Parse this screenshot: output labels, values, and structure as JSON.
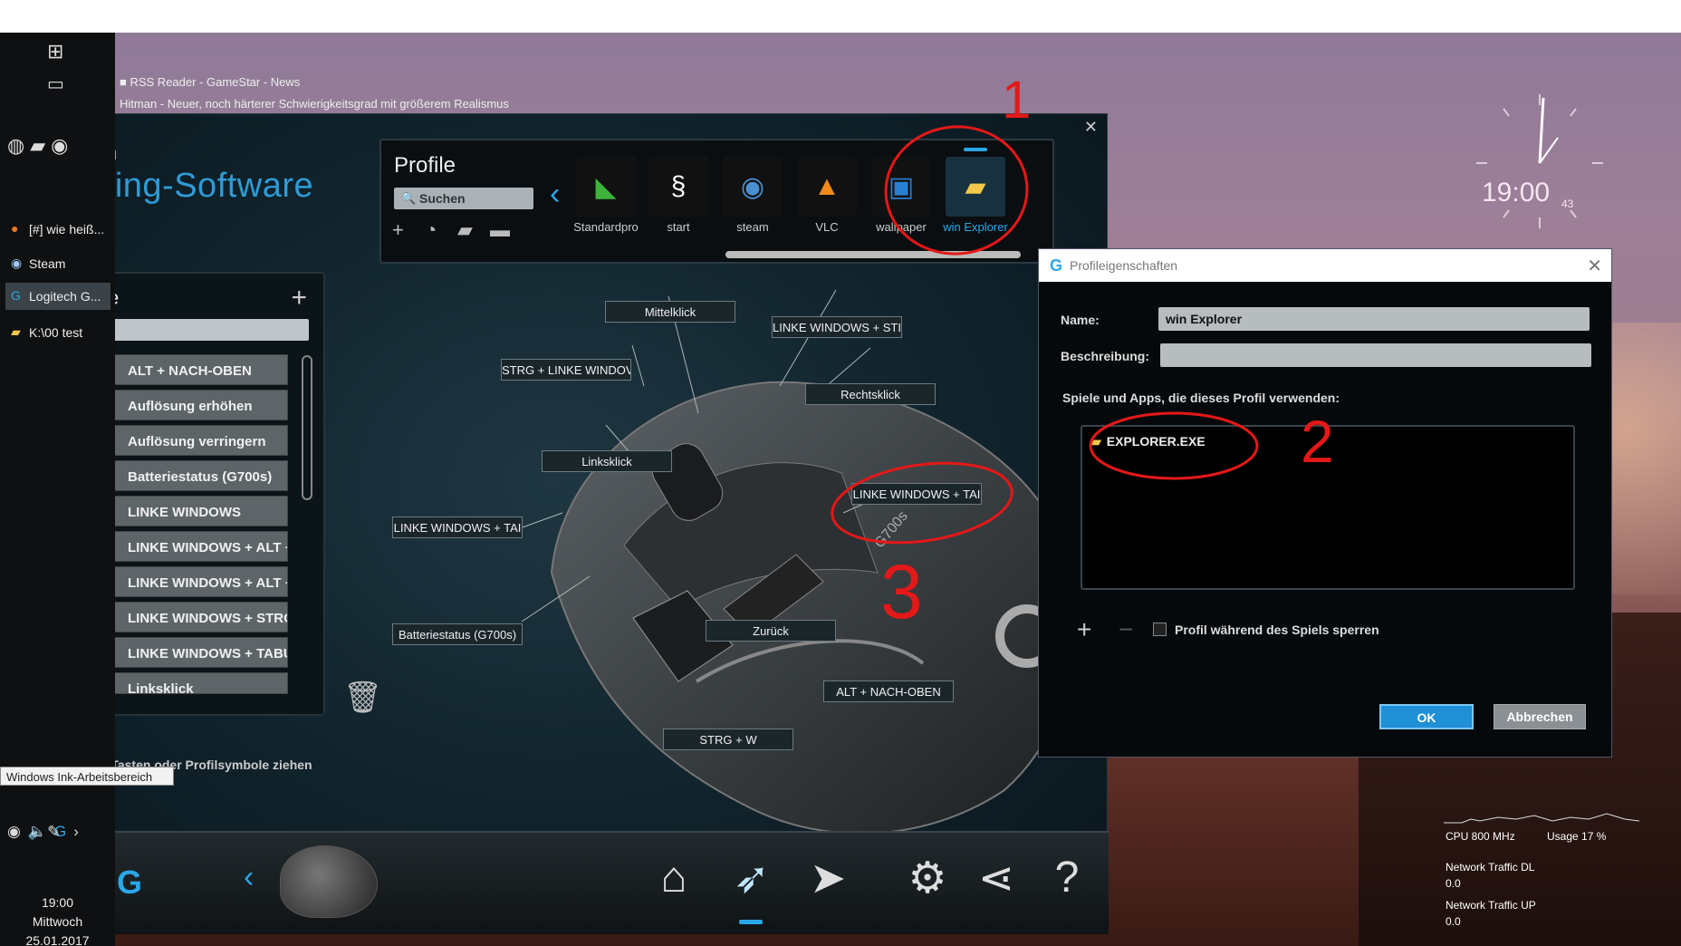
{
  "taskbar": {
    "items": [
      {
        "label": "[#] wie heiß...",
        "icon": "firefox-icon"
      },
      {
        "label": "Steam",
        "icon": "steam-icon"
      },
      {
        "label": "Logitech G...",
        "icon": "logitech-icon"
      },
      {
        "label": "K:\\00 test",
        "icon": "folder-icon"
      }
    ],
    "tooltip": "Windows Ink-Arbeitsbereich",
    "clock": {
      "time": "19:00",
      "day": "Mittwoch",
      "date": "25.01.2017"
    }
  },
  "desktop": {
    "rss_line1": "RSS Reader - GameStar - News",
    "rss_line2": "Hitman - Neuer, noch härterer Schwierigkeitsgrad mit größerem Realismus",
    "clock_time": "19:00",
    "clock_seconds": "43",
    "cpu": "CPU 800 MHz",
    "usage": "Usage 17 %",
    "net_dl": "Network Traffic DL",
    "net_dl_val": "0.0",
    "net_up": "Network Traffic UP",
    "net_up_val": "0.0"
  },
  "gaming_software": {
    "title_partial": "ch",
    "title": "Gaming-Software",
    "profile": {
      "title": "Profile",
      "search_placeholder": "Suchen",
      "items": [
        {
          "label": "Standardpro",
          "icon": "standard-profile-icon",
          "color": "#111"
        },
        {
          "label": "start",
          "icon": "script-icon",
          "color": "#111"
        },
        {
          "label": "steam",
          "icon": "steam-icon",
          "color": "#111"
        },
        {
          "label": "VLC",
          "icon": "vlc-icon",
          "color": "#111"
        },
        {
          "label": "wallpaper",
          "icon": "wallpaper-icon",
          "color": "#111"
        },
        {
          "label": "win Explorer",
          "icon": "folder-icon",
          "color": "#2aa7e8"
        }
      ]
    },
    "commands": {
      "header_partial": "e",
      "search_partial": "n",
      "items": [
        "ALT + NACH-OBEN",
        "Auflösung erhöhen",
        "Auflösung verringern",
        "Batteriestatus (G700s)",
        "LINKE WINDOWS",
        "LINKE WINDOWS + ALT + NACH",
        "LINKE WINDOWS + ALT + NACH",
        "LINKE WINDOWS + STRG + NAC",
        "LINKE WINDOWS + TABULATOI",
        "Linksklick"
      ]
    },
    "hint": "Befehle auf Tasten oder Profilsymbole ziehen",
    "mouse_labels": {
      "middle": "Mittelklick",
      "ctrl_win_top": "LINKE WINDOWS + STI",
      "ctrl_win": "STRG + LINKE WINDOV",
      "right": "Rechtsklick",
      "left": "Linksklick",
      "win_tab_right": "LINKE WINDOWS + TAI",
      "win_tab_left": "LINKE WINDOWS + TAI",
      "battery": "Batteriestatus (G700s)",
      "back": "Zurück",
      "alt_up": "ALT + NACH-OBEN",
      "ctrl_w": "STRG + W"
    },
    "mouse_model": "G700s"
  },
  "dialog": {
    "title": "Profileigenschaften",
    "name_label": "Name:",
    "name_value": "win Explorer",
    "desc_label": "Beschreibung:",
    "desc_value": "",
    "apps_label": "Spiele und Apps, die dieses Profil verwenden:",
    "app_item": "EXPLORER.EXE",
    "lock_label": "Profil während des Spiels sperren",
    "ok": "OK",
    "cancel": "Abbrechen"
  },
  "annotations": {
    "n1": "1",
    "n2": "2",
    "n3": "3"
  }
}
